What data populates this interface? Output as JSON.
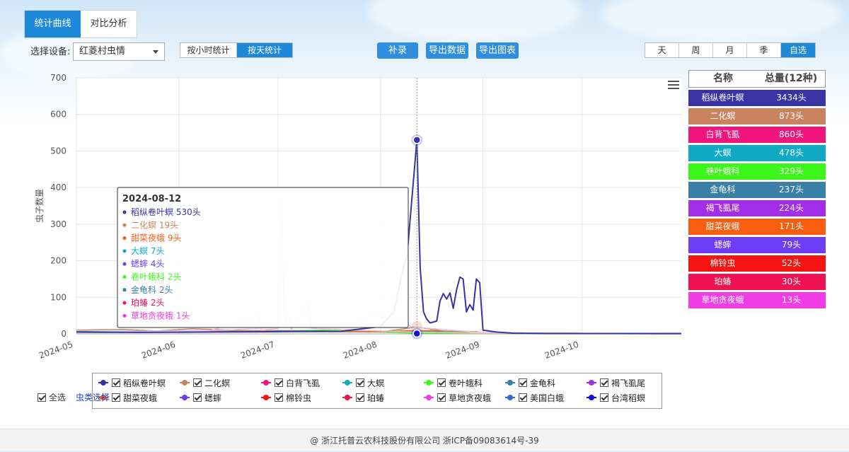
{
  "tabs": [
    {
      "label": "统计曲线",
      "active": true
    },
    {
      "label": "对比分析",
      "active": false
    }
  ],
  "device": {
    "label": "选择设备:",
    "value": "红菱村虫情"
  },
  "stat_mode": [
    {
      "label": "按小时统计",
      "active": false
    },
    {
      "label": "按天统计",
      "active": true
    }
  ],
  "actions": {
    "supplement": "补录",
    "export_data": "导出数据",
    "export_chart": "导出图表"
  },
  "periods": [
    {
      "label": "天",
      "active": false
    },
    {
      "label": "周",
      "active": false
    },
    {
      "label": "月",
      "active": false
    },
    {
      "label": "季",
      "active": false
    },
    {
      "label": "自选",
      "active": true
    }
  ],
  "totals_table": {
    "header_name": "名称",
    "header_total": "总量(12种)",
    "rows": [
      {
        "name": "稻纵卷叶螟",
        "total": "3434头",
        "color": "#3a33a6"
      },
      {
        "name": "二化螟",
        "total": "873头",
        "color": "#c9845f"
      },
      {
        "name": "白背飞虱",
        "total": "860头",
        "color": "#f0157c"
      },
      {
        "name": "大螟",
        "total": "478头",
        "color": "#11aac4"
      },
      {
        "name": "卷叶蛾科",
        "total": "329头",
        "color": "#3cf519"
      },
      {
        "name": "金龟科",
        "total": "237头",
        "color": "#3a7fa8"
      },
      {
        "name": "褐飞虱尾",
        "total": "224头",
        "color": "#a22ee8"
      },
      {
        "name": "甜菜夜蛾",
        "total": "171头",
        "color": "#f95d10"
      },
      {
        "name": "蟋蟀",
        "total": "79头",
        "color": "#6e3cf5"
      },
      {
        "name": "棉铃虫",
        "total": "52头",
        "color": "#f51414"
      },
      {
        "name": "珀蝽",
        "total": "30头",
        "color": "#ef1152"
      },
      {
        "name": "草地贪夜蛾",
        "total": "13头",
        "color": "#f23ce8"
      }
    ]
  },
  "legend": [
    {
      "name": "稻纵卷叶螟",
      "color": "#3a33a6"
    },
    {
      "name": "二化螟",
      "color": "#c9845f"
    },
    {
      "name": "白背飞虱",
      "color": "#f0157c"
    },
    {
      "name": "大螟",
      "color": "#11aac4"
    },
    {
      "name": "卷叶蛾科",
      "color": "#3cf519"
    },
    {
      "name": "金龟科",
      "color": "#3a7fa8"
    },
    {
      "name": "褐飞虱尾",
      "color": "#a22ee8"
    },
    {
      "name": "甜菜夜蛾",
      "color": "#f95d10"
    },
    {
      "name": "蟋蟀",
      "color": "#6e3cf5"
    },
    {
      "name": "棉铃虫",
      "color": "#f51414"
    },
    {
      "name": "珀蝽",
      "color": "#ef1152"
    },
    {
      "name": "草地贪夜蛾",
      "color": "#f23ce8"
    },
    {
      "name": "美国白蛾",
      "color": "#3a68d6"
    },
    {
      "name": "台湾稻螟",
      "color": "#1212e0"
    }
  ],
  "select_all": "全选",
  "bug_select": "虫类选择",
  "footer": "@ 浙江托普云农科技股份有限公司 浙ICP备09083614号-39",
  "chart_data": {
    "type": "line",
    "ylabel": "虫子数量",
    "xlabel": "",
    "ylim": [
      0,
      700
    ],
    "yticks": [
      0,
      100,
      200,
      300,
      400,
      500,
      600,
      700
    ],
    "xlim": [
      "2024-05-01",
      "2024-10-31"
    ],
    "xticks": [
      "2024-05",
      "2024-06",
      "2024-07",
      "2024-08",
      "2024-09",
      "2024-10"
    ],
    "grid": true,
    "series": [
      {
        "name": "稻纵卷叶螟",
        "color": "#3a33a6",
        "points": [
          [
            "2024-05-01",
            5
          ],
          [
            "2024-05-20",
            4
          ],
          [
            "2024-06-10",
            5
          ],
          [
            "2024-07-01",
            6
          ],
          [
            "2024-07-20",
            7
          ],
          [
            "2024-08-01",
            20
          ],
          [
            "2024-08-05",
            60
          ],
          [
            "2024-08-08",
            185
          ],
          [
            "2024-08-09",
            210
          ],
          [
            "2024-08-12",
            530
          ],
          [
            "2024-08-13",
            180
          ],
          [
            "2024-08-14",
            60
          ],
          [
            "2024-08-15",
            40
          ],
          [
            "2024-08-16",
            30
          ],
          [
            "2024-08-18",
            35
          ],
          [
            "2024-08-19",
            90
          ],
          [
            "2024-08-20",
            110
          ],
          [
            "2024-08-21",
            95
          ],
          [
            "2024-08-22",
            112
          ],
          [
            "2024-08-23",
            70
          ],
          [
            "2024-08-24",
            120
          ],
          [
            "2024-08-25",
            155
          ],
          [
            "2024-08-26",
            150
          ],
          [
            "2024-08-27",
            60
          ],
          [
            "2024-08-28",
            80
          ],
          [
            "2024-08-29",
            65
          ],
          [
            "2024-08-30",
            150
          ],
          [
            "2024-08-31",
            140
          ],
          [
            "2024-09-01",
            10
          ],
          [
            "2024-09-05",
            5
          ],
          [
            "2024-09-10",
            2
          ],
          [
            "2024-09-20",
            1
          ],
          [
            "2024-10-31",
            1
          ]
        ]
      },
      {
        "name": "白背飞虱",
        "color": "#f9bcd4",
        "points": [
          [
            "2024-05-01",
            3
          ],
          [
            "2024-05-20",
            5
          ],
          [
            "2024-06-10",
            8
          ],
          [
            "2024-06-25",
            50
          ],
          [
            "2024-06-26",
            10
          ],
          [
            "2024-07-01",
            15
          ],
          [
            "2024-07-02",
            365
          ],
          [
            "2024-07-03",
            20
          ],
          [
            "2024-07-04",
            60
          ],
          [
            "2024-07-05",
            10
          ],
          [
            "2024-07-10",
            90
          ],
          [
            "2024-07-11",
            15
          ],
          [
            "2024-07-20",
            12
          ],
          [
            "2024-08-01",
            8
          ],
          [
            "2024-08-10",
            5
          ],
          [
            "2024-09-01",
            2
          ],
          [
            "2024-10-31",
            0
          ]
        ]
      },
      {
        "name": "褐飞虱尾",
        "color": "#d8cdf2",
        "points": [
          [
            "2024-05-01",
            5
          ],
          [
            "2024-06-15",
            10
          ],
          [
            "2024-07-15",
            25
          ],
          [
            "2024-07-25",
            30
          ],
          [
            "2024-07-30",
            55
          ],
          [
            "2024-08-01",
            45
          ],
          [
            "2024-08-03",
            50
          ],
          [
            "2024-08-05",
            35
          ],
          [
            "2024-08-08",
            40
          ],
          [
            "2024-08-10",
            20
          ],
          [
            "2024-09-01",
            3
          ],
          [
            "2024-10-31",
            0
          ]
        ]
      },
      {
        "name": "二化螟",
        "color": "#c9845f",
        "points": [
          [
            "2024-05-01",
            10
          ],
          [
            "2024-05-15",
            12
          ],
          [
            "2024-05-25",
            8
          ],
          [
            "2024-06-05",
            14
          ],
          [
            "2024-06-20",
            9
          ],
          [
            "2024-07-10",
            6
          ],
          [
            "2024-08-01",
            5
          ],
          [
            "2024-08-12",
            19
          ],
          [
            "2024-08-20",
            8
          ],
          [
            "2024-09-01",
            3
          ],
          [
            "2024-10-31",
            0
          ]
        ]
      },
      {
        "name": "甜菜夜蛾",
        "color": "#f95d10",
        "points": [
          [
            "2024-05-01",
            4
          ],
          [
            "2024-06-01",
            6
          ],
          [
            "2024-07-01",
            8
          ],
          [
            "2024-08-01",
            6
          ],
          [
            "2024-08-12",
            9
          ],
          [
            "2024-08-30",
            6
          ],
          [
            "2024-09-01",
            2
          ],
          [
            "2024-10-31",
            0
          ]
        ]
      },
      {
        "name": "大螟",
        "color": "#11aac4",
        "points": [
          [
            "2024-05-01",
            6
          ],
          [
            "2024-06-01",
            8
          ],
          [
            "2024-07-01",
            9
          ],
          [
            "2024-08-01",
            6
          ],
          [
            "2024-08-12",
            7
          ],
          [
            "2024-09-01",
            3
          ],
          [
            "2024-10-31",
            0
          ]
        ]
      },
      {
        "name": "卷叶蛾科",
        "color": "#3cf519",
        "points": [
          [
            "2024-05-01",
            3
          ],
          [
            "2024-06-15",
            6
          ],
          [
            "2024-07-15",
            10
          ],
          [
            "2024-08-12",
            2
          ],
          [
            "2024-09-01",
            1
          ],
          [
            "2024-10-31",
            0
          ]
        ]
      }
    ],
    "tooltip": {
      "date": "2024-08-12",
      "items": [
        {
          "name": "稻纵卷叶螟",
          "value": "530头",
          "color": "#3a33a6"
        },
        {
          "name": "二化螟",
          "value": "19头",
          "color": "#c9845f"
        },
        {
          "name": "甜菜夜蛾",
          "value": "9头",
          "color": "#f95d10"
        },
        {
          "name": "大螟",
          "value": "7头",
          "color": "#11aac4"
        },
        {
          "name": "蟋蟀",
          "value": "4头",
          "color": "#6e3cf5"
        },
        {
          "name": "卷叶蛾科",
          "value": "2头",
          "color": "#3cf519"
        },
        {
          "name": "金龟科",
          "value": "2头",
          "color": "#3a7fa8"
        },
        {
          "name": "珀蝽",
          "value": "2头",
          "color": "#ef1152"
        },
        {
          "name": "草地贪夜蛾",
          "value": "1头",
          "color": "#f23ce8"
        }
      ]
    }
  }
}
